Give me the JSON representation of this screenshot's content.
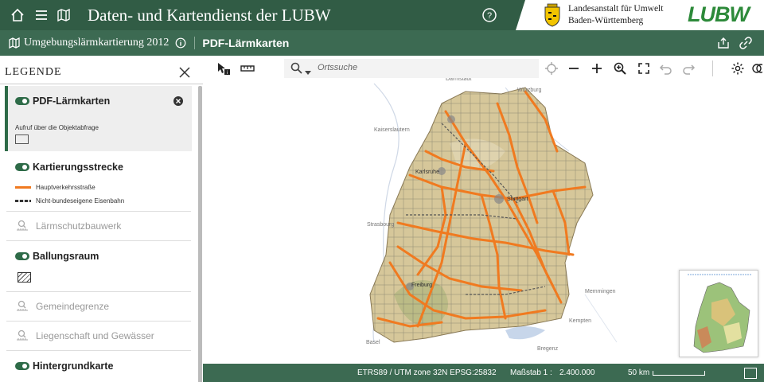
{
  "header": {
    "title": "Daten- und Kartendienst der LUBW",
    "agency_line1": "Landesanstalt für Umwelt",
    "agency_line2": "Baden-Württemberg",
    "logo_text": "LUBW",
    "icons": [
      "home-icon",
      "menu-icon",
      "map-icon",
      "help-icon"
    ]
  },
  "subheader": {
    "project": "Umgebungslärmkartierung 2012",
    "section": "PDF-Lärmkarten",
    "icons": [
      "map-icon",
      "info-icon",
      "share-icon",
      "link-icon"
    ]
  },
  "legend": {
    "title": "LEGENDE",
    "groups": [
      {
        "title": "PDF-Lärmkarten",
        "note": "Aufruf über die Objektabfrage",
        "enabled": true
      },
      {
        "title": "Kartierungsstrecke",
        "items": [
          "Hauptverkehrsstraße",
          "Nicht-bundeseigene Eisenbahn"
        ],
        "enabled": true
      },
      {
        "title": "Lärmschutzbauwerk",
        "enabled": false
      },
      {
        "title": "Ballungsraum",
        "enabled": true
      },
      {
        "title": "Gemeindegrenze",
        "enabled": false
      },
      {
        "title": "Liegenschaft und Gewässer",
        "enabled": false
      },
      {
        "title": "Hintergrundkarte",
        "enabled": true
      }
    ]
  },
  "search": {
    "placeholder": "Ortssuche"
  },
  "map": {
    "places": [
      "Würzburg",
      "Kaiserslautern",
      "Stuttgart",
      "Karlsruhe",
      "Strasbourg",
      "Freiburg",
      "Memmingen",
      "Kempten",
      "Bregenz",
      "Basel",
      "Darmstadt"
    ]
  },
  "statusbar": {
    "crs": "ETRS89 / UTM zone 32N EPSG:25832",
    "scale_label": "Maßstab 1 :",
    "scale_value": "2.400.000",
    "scalebar": "50 km"
  },
  "colors": {
    "header": "#315c45",
    "subheader": "#3c6a52",
    "accent": "#2e6b48",
    "route": "#f07a20"
  }
}
